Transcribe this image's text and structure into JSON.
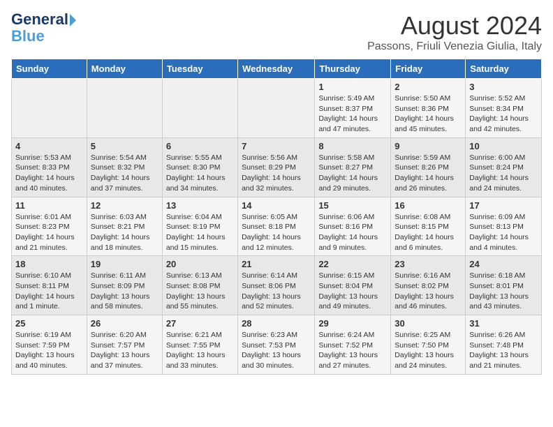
{
  "header": {
    "logo_line1": "General",
    "logo_line2": "Blue",
    "month_title": "August 2024",
    "subtitle": "Passons, Friuli Venezia Giulia, Italy"
  },
  "days_of_week": [
    "Sunday",
    "Monday",
    "Tuesday",
    "Wednesday",
    "Thursday",
    "Friday",
    "Saturday"
  ],
  "weeks": [
    [
      {
        "day": "",
        "info": ""
      },
      {
        "day": "",
        "info": ""
      },
      {
        "day": "",
        "info": ""
      },
      {
        "day": "",
        "info": ""
      },
      {
        "day": "1",
        "info": "Sunrise: 5:49 AM\nSunset: 8:37 PM\nDaylight: 14 hours\nand 47 minutes."
      },
      {
        "day": "2",
        "info": "Sunrise: 5:50 AM\nSunset: 8:36 PM\nDaylight: 14 hours\nand 45 minutes."
      },
      {
        "day": "3",
        "info": "Sunrise: 5:52 AM\nSunset: 8:34 PM\nDaylight: 14 hours\nand 42 minutes."
      }
    ],
    [
      {
        "day": "4",
        "info": "Sunrise: 5:53 AM\nSunset: 8:33 PM\nDaylight: 14 hours\nand 40 minutes."
      },
      {
        "day": "5",
        "info": "Sunrise: 5:54 AM\nSunset: 8:32 PM\nDaylight: 14 hours\nand 37 minutes."
      },
      {
        "day": "6",
        "info": "Sunrise: 5:55 AM\nSunset: 8:30 PM\nDaylight: 14 hours\nand 34 minutes."
      },
      {
        "day": "7",
        "info": "Sunrise: 5:56 AM\nSunset: 8:29 PM\nDaylight: 14 hours\nand 32 minutes."
      },
      {
        "day": "8",
        "info": "Sunrise: 5:58 AM\nSunset: 8:27 PM\nDaylight: 14 hours\nand 29 minutes."
      },
      {
        "day": "9",
        "info": "Sunrise: 5:59 AM\nSunset: 8:26 PM\nDaylight: 14 hours\nand 26 minutes."
      },
      {
        "day": "10",
        "info": "Sunrise: 6:00 AM\nSunset: 8:24 PM\nDaylight: 14 hours\nand 24 minutes."
      }
    ],
    [
      {
        "day": "11",
        "info": "Sunrise: 6:01 AM\nSunset: 8:23 PM\nDaylight: 14 hours\nand 21 minutes."
      },
      {
        "day": "12",
        "info": "Sunrise: 6:03 AM\nSunset: 8:21 PM\nDaylight: 14 hours\nand 18 minutes."
      },
      {
        "day": "13",
        "info": "Sunrise: 6:04 AM\nSunset: 8:19 PM\nDaylight: 14 hours\nand 15 minutes."
      },
      {
        "day": "14",
        "info": "Sunrise: 6:05 AM\nSunset: 8:18 PM\nDaylight: 14 hours\nand 12 minutes."
      },
      {
        "day": "15",
        "info": "Sunrise: 6:06 AM\nSunset: 8:16 PM\nDaylight: 14 hours\nand 9 minutes."
      },
      {
        "day": "16",
        "info": "Sunrise: 6:08 AM\nSunset: 8:15 PM\nDaylight: 14 hours\nand 6 minutes."
      },
      {
        "day": "17",
        "info": "Sunrise: 6:09 AM\nSunset: 8:13 PM\nDaylight: 14 hours\nand 4 minutes."
      }
    ],
    [
      {
        "day": "18",
        "info": "Sunrise: 6:10 AM\nSunset: 8:11 PM\nDaylight: 14 hours\nand 1 minute."
      },
      {
        "day": "19",
        "info": "Sunrise: 6:11 AM\nSunset: 8:09 PM\nDaylight: 13 hours\nand 58 minutes."
      },
      {
        "day": "20",
        "info": "Sunrise: 6:13 AM\nSunset: 8:08 PM\nDaylight: 13 hours\nand 55 minutes."
      },
      {
        "day": "21",
        "info": "Sunrise: 6:14 AM\nSunset: 8:06 PM\nDaylight: 13 hours\nand 52 minutes."
      },
      {
        "day": "22",
        "info": "Sunrise: 6:15 AM\nSunset: 8:04 PM\nDaylight: 13 hours\nand 49 minutes."
      },
      {
        "day": "23",
        "info": "Sunrise: 6:16 AM\nSunset: 8:02 PM\nDaylight: 13 hours\nand 46 minutes."
      },
      {
        "day": "24",
        "info": "Sunrise: 6:18 AM\nSunset: 8:01 PM\nDaylight: 13 hours\nand 43 minutes."
      }
    ],
    [
      {
        "day": "25",
        "info": "Sunrise: 6:19 AM\nSunset: 7:59 PM\nDaylight: 13 hours\nand 40 minutes."
      },
      {
        "day": "26",
        "info": "Sunrise: 6:20 AM\nSunset: 7:57 PM\nDaylight: 13 hours\nand 37 minutes."
      },
      {
        "day": "27",
        "info": "Sunrise: 6:21 AM\nSunset: 7:55 PM\nDaylight: 13 hours\nand 33 minutes."
      },
      {
        "day": "28",
        "info": "Sunrise: 6:23 AM\nSunset: 7:53 PM\nDaylight: 13 hours\nand 30 minutes."
      },
      {
        "day": "29",
        "info": "Sunrise: 6:24 AM\nSunset: 7:52 PM\nDaylight: 13 hours\nand 27 minutes."
      },
      {
        "day": "30",
        "info": "Sunrise: 6:25 AM\nSunset: 7:50 PM\nDaylight: 13 hours\nand 24 minutes."
      },
      {
        "day": "31",
        "info": "Sunrise: 6:26 AM\nSunset: 7:48 PM\nDaylight: 13 hours\nand 21 minutes."
      }
    ]
  ]
}
